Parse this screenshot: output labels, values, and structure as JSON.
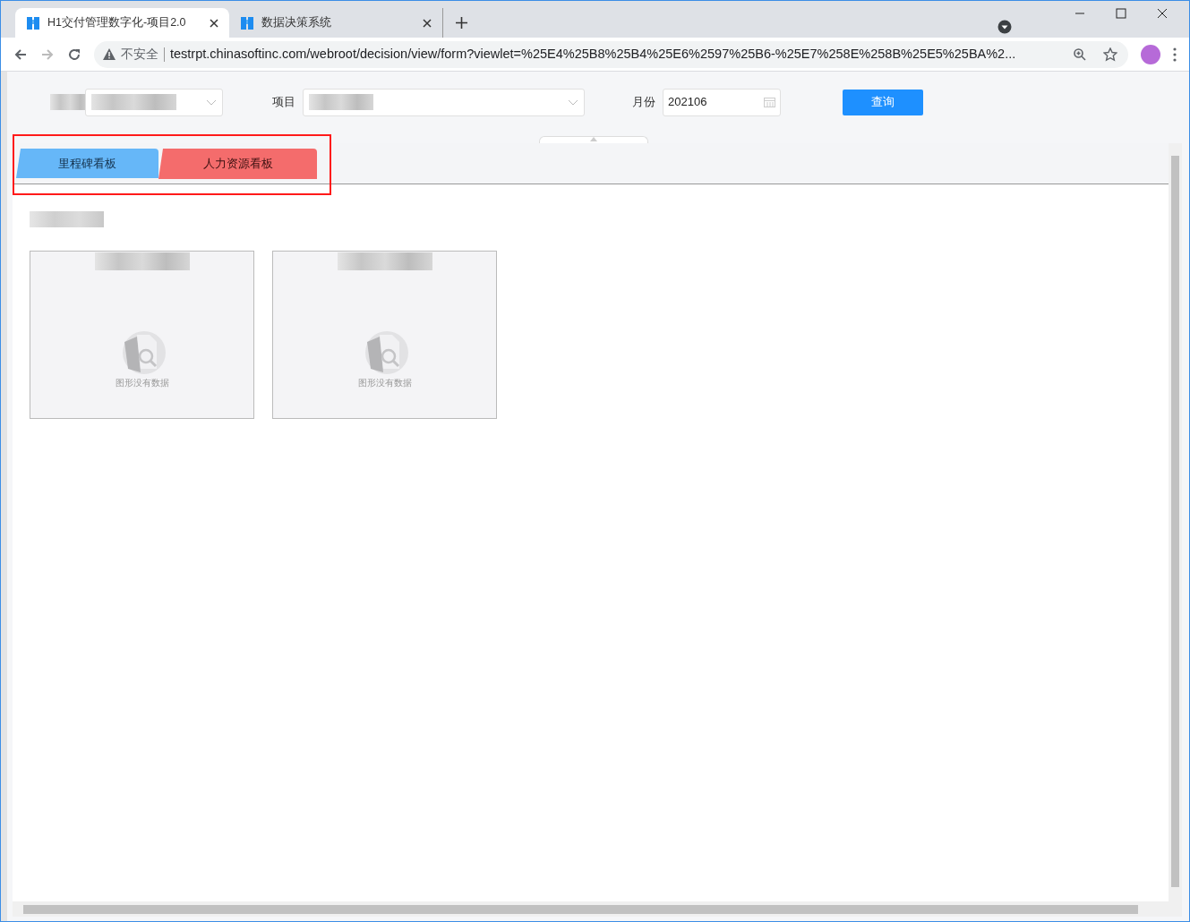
{
  "browser": {
    "tabs": [
      {
        "title": "H1交付管理数字化-项目2.0",
        "selected": true
      },
      {
        "title": "数据决策系统",
        "selected": false
      }
    ],
    "address": {
      "security": "不安全",
      "url": "testrpt.chinasoftinc.com/webroot/decision/view/form?viewlet=%25E4%25B8%25B4%25E6%2597%25B6-%25E7%258E%258B%25E5%25BA%2..."
    }
  },
  "filters": [
    {
      "kind": "select",
      "redacted": true
    },
    {
      "kind": "select",
      "label": "项目",
      "redacted": true
    },
    {
      "kind": "date",
      "label": "月份",
      "value": "202106"
    },
    {
      "kind": "button",
      "label": "查询"
    }
  ],
  "dashboard_tabs": [
    {
      "label": "里程碑看板",
      "color": "#66b7f8",
      "selected": false
    },
    {
      "label": "人力资源看板",
      "color": "#f46c6c",
      "selected": true
    }
  ],
  "charts": [
    {
      "empty_text": "图形没有数据"
    },
    {
      "empty_text": "图形没有数据"
    }
  ]
}
